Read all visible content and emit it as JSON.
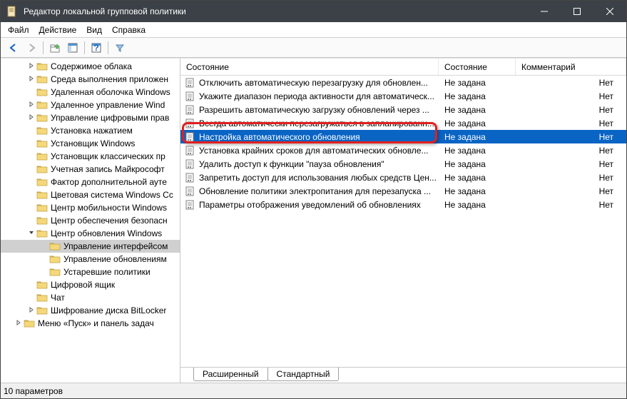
{
  "window": {
    "title": "Редактор локальной групповой политики"
  },
  "menubar": {
    "file": "Файл",
    "action": "Действие",
    "view": "Вид",
    "help": "Справка"
  },
  "tree": {
    "items": [
      {
        "label": "Содержимое облака",
        "indent": 1,
        "exp": ">",
        "sel": false
      },
      {
        "label": "Среда выполнения приложен",
        "indent": 1,
        "exp": ">",
        "sel": false
      },
      {
        "label": "Удаленная оболочка Windows",
        "indent": 1,
        "exp": "",
        "sel": false
      },
      {
        "label": "Удаленное управление Wind",
        "indent": 1,
        "exp": ">",
        "sel": false
      },
      {
        "label": "Управление цифровыми прав",
        "indent": 1,
        "exp": ">",
        "sel": false
      },
      {
        "label": "Установка нажатием",
        "indent": 1,
        "exp": "",
        "sel": false
      },
      {
        "label": "Установщик Windows",
        "indent": 1,
        "exp": "",
        "sel": false
      },
      {
        "label": "Установщик классических пр",
        "indent": 1,
        "exp": "",
        "sel": false
      },
      {
        "label": "Учетная запись Майкрософт",
        "indent": 1,
        "exp": "",
        "sel": false
      },
      {
        "label": "Фактор дополнительной ауте",
        "indent": 1,
        "exp": "",
        "sel": false
      },
      {
        "label": "Цветовая система Windows Cc",
        "indent": 1,
        "exp": "",
        "sel": false
      },
      {
        "label": "Центр мобильности Windows",
        "indent": 1,
        "exp": "",
        "sel": false
      },
      {
        "label": "Центр обеспечения безопасн",
        "indent": 1,
        "exp": "",
        "sel": false
      },
      {
        "label": "Центр обновления Windows",
        "indent": 1,
        "exp": "v",
        "sel": false
      },
      {
        "label": "Управление интерфейсом",
        "indent": 2,
        "exp": "",
        "sel": true
      },
      {
        "label": "Управление обновлениям",
        "indent": 2,
        "exp": "",
        "sel": false
      },
      {
        "label": "Устаревшие политики",
        "indent": 2,
        "exp": "",
        "sel": false
      },
      {
        "label": "Цифровой ящик",
        "indent": 1,
        "exp": "",
        "sel": false
      },
      {
        "label": "Чат",
        "indent": 1,
        "exp": "",
        "sel": false
      },
      {
        "label": "Шифрование диска BitLocker",
        "indent": 1,
        "exp": ">",
        "sel": false
      },
      {
        "label": "Меню «Пуск» и панель задач",
        "indent": 0,
        "exp": ">",
        "sel": false
      }
    ]
  },
  "list": {
    "columns": {
      "name": "Состояние",
      "state": "Состояние",
      "comment": "Комментарий"
    },
    "rows": [
      {
        "name": "Отключить автоматическую перезагрузку для обновлен...",
        "state": "Не задана",
        "comment": "Нет",
        "sel": false
      },
      {
        "name": "Укажите диапазон периода активности для автоматическ...",
        "state": "Не задана",
        "comment": "Нет",
        "sel": false
      },
      {
        "name": "Разрешить автоматическую загрузку обновлений через ...",
        "state": "Не задана",
        "comment": "Нет",
        "sel": false
      },
      {
        "name": "Всегда автоматически перезагружаться в запланированн...",
        "state": "Не задана",
        "comment": "Нет",
        "sel": false
      },
      {
        "name": "Настройка автоматического обновления",
        "state": "Не задана",
        "comment": "Нет",
        "sel": true
      },
      {
        "name": "Установка крайних сроков для автоматических обновле...",
        "state": "Не задана",
        "comment": "Нет",
        "sel": false
      },
      {
        "name": "Удалить доступ к функции \"пауза обновления\"",
        "state": "Не задана",
        "comment": "Нет",
        "sel": false
      },
      {
        "name": "Запретить доступ для использования любых средств Цен...",
        "state": "Не задана",
        "comment": "Нет",
        "sel": false
      },
      {
        "name": "Обновление политики электропитания для перезапуска ...",
        "state": "Не задана",
        "comment": "Нет",
        "sel": false
      },
      {
        "name": "Параметры отображения уведомлений об обновлениях",
        "state": "Не задана",
        "comment": "Нет",
        "sel": false
      }
    ]
  },
  "tabs": {
    "extended": "Расширенный",
    "standard": "Стандартный"
  },
  "statusbar": {
    "text": "10 параметров"
  }
}
